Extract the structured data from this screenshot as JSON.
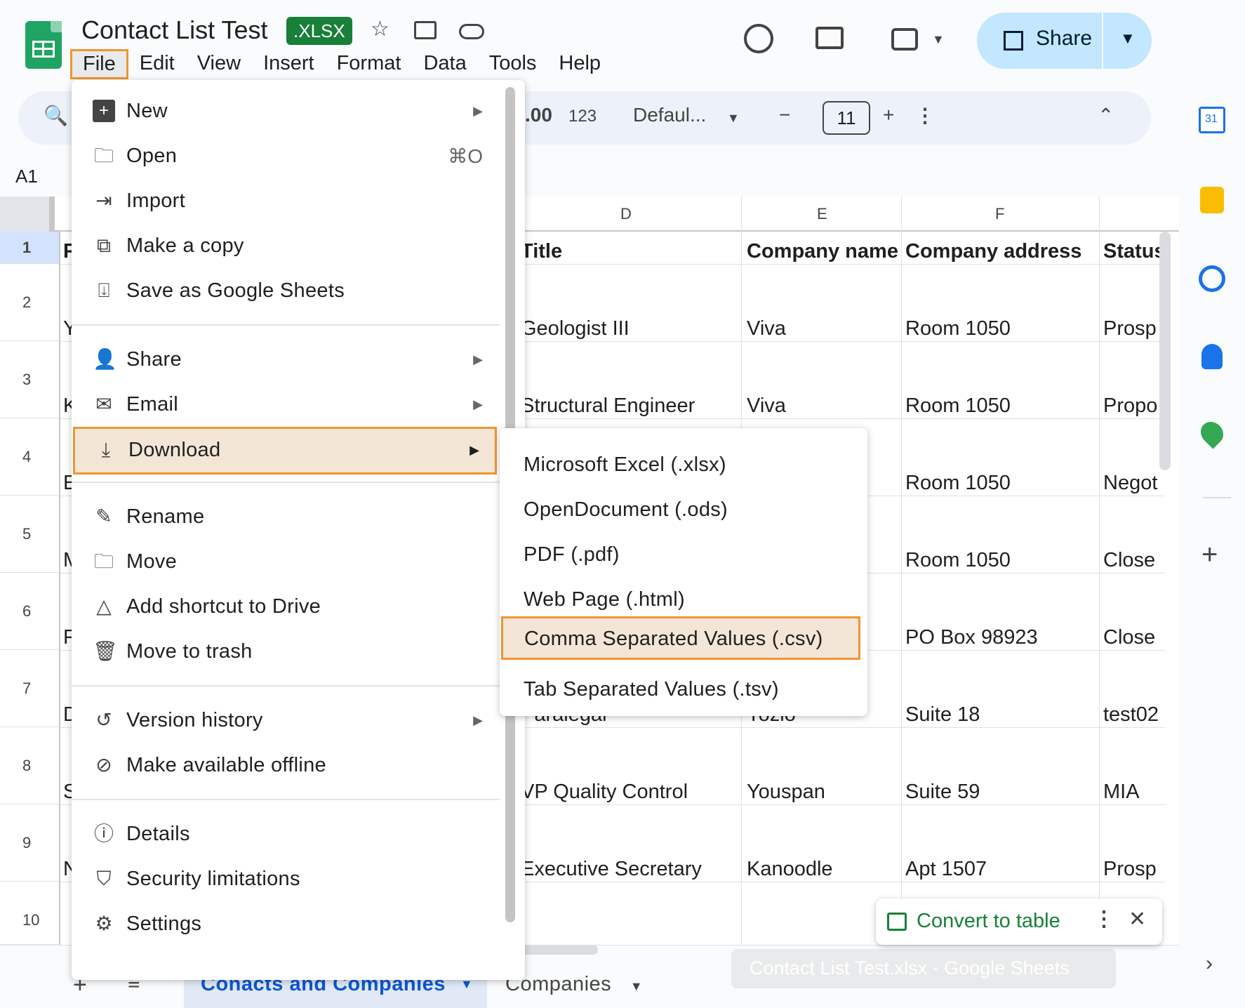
{
  "header": {
    "doc_title": "Contact List Test",
    "file_badge": ".XLSX",
    "share_label": "Share"
  },
  "menubar": [
    "File",
    "Edit",
    "View",
    "Insert",
    "Format",
    "Data",
    "Tools",
    "Help"
  ],
  "toolbar": {
    "decimal_label": ".00",
    "number_format": "123",
    "font_name": "Defaul...",
    "font_size": "11"
  },
  "name_box": "A1",
  "columns": [
    "D",
    "E",
    "F"
  ],
  "rows": [
    "1",
    "2",
    "3",
    "4",
    "5",
    "6",
    "7",
    "8",
    "9",
    "10"
  ],
  "cells": {
    "header": [
      "Title",
      "Company name",
      "Company address",
      "Status"
    ],
    "col_a_fragments": [
      "F",
      "Y",
      "K",
      "E",
      "M",
      "F",
      "D",
      "S",
      "N"
    ],
    "r2": [
      "Geologist III",
      "Viva",
      "Room 1050",
      "Prosp"
    ],
    "r3": [
      "Structural Engineer",
      "Viva",
      "Room 1050",
      "Propo"
    ],
    "r4": [
      "Room 1050",
      "Negot"
    ],
    "r5": [
      "Room 1050",
      "Close"
    ],
    "r6": [
      "PO Box 98923",
      "Close"
    ],
    "r7": [
      "Paralegal",
      "Yozio",
      "Suite 18",
      "test02"
    ],
    "r8": [
      "VP Quality Control",
      "Youspan",
      "Suite 59",
      "MIA"
    ],
    "r9": [
      "Executive Secretary",
      "Kanoodle",
      "Apt 1507",
      "Prosp"
    ]
  },
  "file_menu": {
    "items": [
      {
        "label": "New",
        "icon": "new-sheet-icon",
        "arrow": true
      },
      {
        "label": "Open",
        "icon": "folder-icon",
        "shortcut": "⌘O"
      },
      {
        "label": "Import",
        "icon": "import-icon"
      },
      {
        "label": "Make a copy",
        "icon": "copy-icon"
      },
      {
        "label": "Save as Google Sheets",
        "icon": "save-icon"
      },
      {
        "label": "Share",
        "icon": "person-add-icon",
        "arrow": true
      },
      {
        "label": "Email",
        "icon": "email-icon",
        "arrow": true
      },
      {
        "label": "Download",
        "icon": "download-icon",
        "arrow": true,
        "highlighted": true
      },
      {
        "label": "Rename",
        "icon": "pencil-icon"
      },
      {
        "label": "Move",
        "icon": "move-folder-icon"
      },
      {
        "label": "Add shortcut to Drive",
        "icon": "drive-shortcut-icon"
      },
      {
        "label": "Move to trash",
        "icon": "trash-icon"
      },
      {
        "label": "Version history",
        "icon": "history-icon",
        "arrow": true
      },
      {
        "label": "Make available offline",
        "icon": "offline-icon"
      },
      {
        "label": "Details",
        "icon": "info-icon"
      },
      {
        "label": "Security limitations",
        "icon": "shield-icon"
      },
      {
        "label": "Settings",
        "icon": "gear-icon"
      }
    ]
  },
  "download_submenu": [
    "Microsoft Excel (.xlsx)",
    "OpenDocument (.ods)",
    "PDF (.pdf)",
    "Web Page (.html)",
    "Comma Separated Values (.csv)",
    "Tab Separated Values (.tsv)"
  ],
  "sheet_tabs": [
    "Conacts and Companies",
    "Companies"
  ],
  "tooltip": "Contact List Test.xlsx - Google Sheets",
  "convert_label": "Convert to table",
  "side_panel": {
    "calendar_day": "31"
  },
  "colors": {
    "highlight_border": "#f0952f",
    "highlight_fill": "#f3e6d6",
    "share_bg": "#c2e7ff",
    "sheets_green": "#1fa463"
  }
}
